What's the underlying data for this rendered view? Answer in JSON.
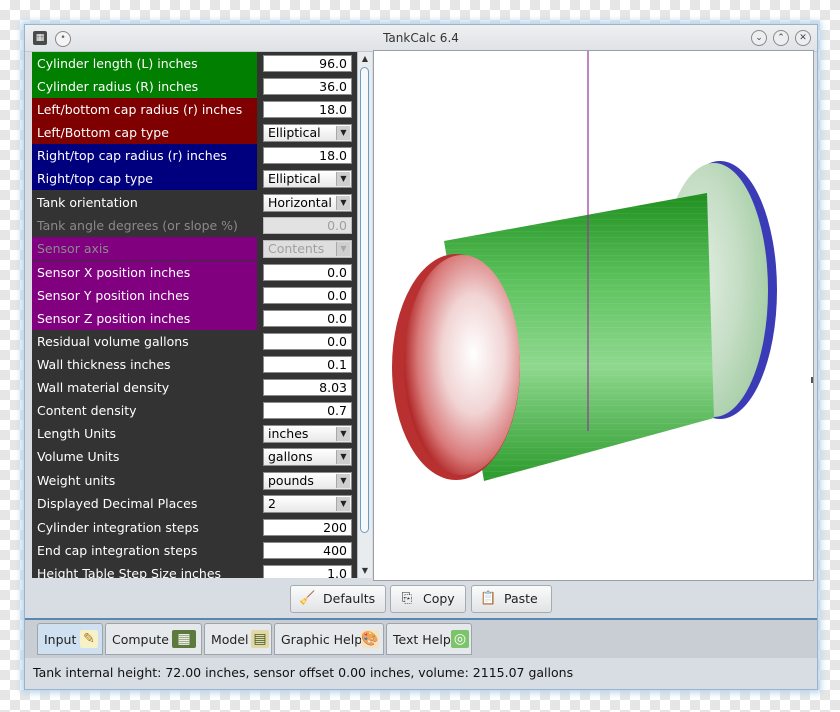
{
  "window": {
    "title": "TankCalc 6.4",
    "controls": [
      "minimize",
      "maximize",
      "close"
    ]
  },
  "colors": {
    "cylinder_rows": "#007f00",
    "left_cap_rows": "#7f0000",
    "right_cap_rows": "#00007f",
    "sensor_rows": "#800080",
    "default_rows": "#333333",
    "tab_bar_accent": "#5a87b0"
  },
  "form": {
    "rows": [
      {
        "label": "Cylinder length (L) inches",
        "kind": "text",
        "value": "96.0",
        "group": "cylinder",
        "enabled": true
      },
      {
        "label": "Cylinder radius (R) inches",
        "kind": "text",
        "value": "36.0",
        "group": "cylinder",
        "enabled": true
      },
      {
        "label": "Left/bottom cap radius (r) inches",
        "kind": "text",
        "value": "18.0",
        "group": "left_cap",
        "enabled": true
      },
      {
        "label": "Left/Bottom cap type",
        "kind": "select",
        "value": "Elliptical",
        "group": "left_cap",
        "enabled": true
      },
      {
        "label": "Right/top cap radius (r) inches",
        "kind": "text",
        "value": "18.0",
        "group": "right_cap",
        "enabled": true
      },
      {
        "label": "Right/top cap type",
        "kind": "select",
        "value": "Elliptical",
        "group": "right_cap",
        "enabled": true
      },
      {
        "label": "Tank orientation",
        "kind": "select",
        "value": "Horizontal",
        "group": "default",
        "enabled": true
      },
      {
        "label": "Tank angle degrees (or slope %)",
        "kind": "text",
        "value": "0.0",
        "group": "default",
        "enabled": false
      },
      {
        "label": "Sensor axis",
        "kind": "select",
        "value": "Contents",
        "group": "sensor",
        "enabled": false
      },
      {
        "label": "Sensor X position inches",
        "kind": "text",
        "value": "0.0",
        "group": "sensor",
        "enabled": true
      },
      {
        "label": "Sensor Y position inches",
        "kind": "text",
        "value": "0.0",
        "group": "sensor",
        "enabled": true
      },
      {
        "label": "Sensor Z position inches",
        "kind": "text",
        "value": "0.0",
        "group": "sensor",
        "enabled": true
      },
      {
        "label": "Residual volume gallons",
        "kind": "text",
        "value": "0.0",
        "group": "default",
        "enabled": true
      },
      {
        "label": "Wall thickness inches",
        "kind": "text",
        "value": "0.1",
        "group": "default",
        "enabled": true
      },
      {
        "label": "Wall material density",
        "kind": "text",
        "value": "8.03",
        "group": "default",
        "enabled": true
      },
      {
        "label": "Content density",
        "kind": "text",
        "value": "0.7",
        "group": "default",
        "enabled": true
      },
      {
        "label": "Length Units",
        "kind": "select",
        "value": "inches",
        "group": "default",
        "enabled": true
      },
      {
        "label": "Volume Units",
        "kind": "select",
        "value": "gallons",
        "group": "default",
        "enabled": true
      },
      {
        "label": "Weight units",
        "kind": "select",
        "value": "pounds",
        "group": "default",
        "enabled": true
      },
      {
        "label": "Displayed Decimal Places",
        "kind": "select",
        "value": "2",
        "group": "default",
        "enabled": true
      },
      {
        "label": "Cylinder integration steps",
        "kind": "text",
        "value": "200",
        "group": "default",
        "enabled": true
      },
      {
        "label": "End cap integration steps",
        "kind": "text",
        "value": "400",
        "group": "default",
        "enabled": true
      },
      {
        "label": "Height Table Step Size inches",
        "kind": "text",
        "value": "1.0",
        "group": "default",
        "enabled": true
      }
    ]
  },
  "scrollbar": {
    "up_icon": "triangle-up-icon",
    "down_icon": "triangle-down-icon"
  },
  "viewport": {
    "description_icon": "3d-tank-model",
    "left_cap_color": "#cc3333",
    "cylinder_color": "#2faa2f",
    "right_cap_color": "#3434b4",
    "sensor_line_color": "#993399"
  },
  "buttons": {
    "defaults": {
      "label": "Defaults",
      "icon": "broom-icon"
    },
    "copy": {
      "label": "Copy",
      "icon": "copy-icon"
    },
    "paste": {
      "label": "Paste",
      "icon": "clipboard-icon"
    }
  },
  "tabs": [
    {
      "label": "Input",
      "icon": "pencil-notepad-icon",
      "active": true
    },
    {
      "label": "Compute",
      "icon": "calculator-icon",
      "active": false
    },
    {
      "label": "Model",
      "icon": "model-icon",
      "active": false
    },
    {
      "label": "Graphic Help",
      "icon": "paint-palette-icon",
      "active": false
    },
    {
      "label": "Text Help",
      "icon": "lifebuoy-icon",
      "active": false
    }
  ],
  "status": {
    "text": "Tank internal height: 72.00 inches, sensor offset 0.00 inches, volume: 2115.07 gallons"
  }
}
